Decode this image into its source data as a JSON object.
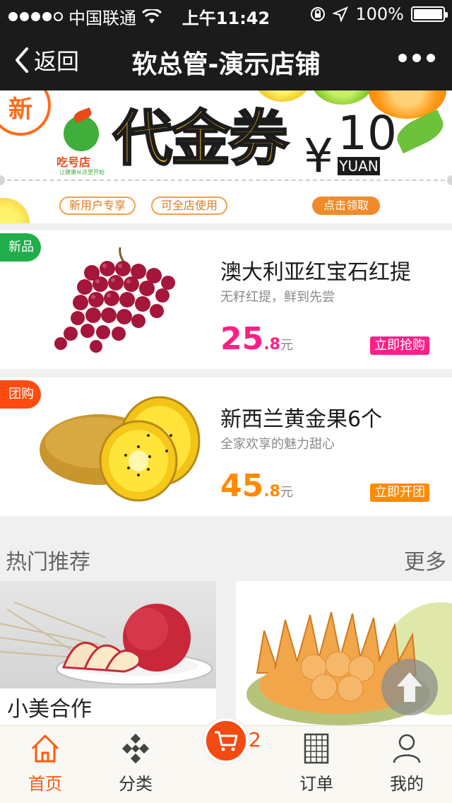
{
  "status_bar": {
    "carrier": "中国联通",
    "time": "上午11:42",
    "battery": "100%",
    "battery_level": 1.0
  },
  "nav": {
    "back_label": "返回",
    "title": "软总管-演示店铺"
  },
  "banner": {
    "new_badge": "新",
    "logo_text": "吃号店",
    "logo_sub": "让健康从这里开始",
    "title": "代金券",
    "currency": "¥",
    "amount": "10",
    "unit": "YUAN",
    "tag1": "新用户专享",
    "tag2": "可全店使用",
    "cta": "点击领取"
  },
  "products": [
    {
      "tag": "新品",
      "tag_color": "#1fae4a",
      "name": "澳大利亚红宝石红提",
      "desc": "无籽红提，鲜到先尝",
      "price_int": "25",
      "price_dec": ".8",
      "price_unit": "元",
      "price_color": "#ff1f86",
      "button": "立即抢购",
      "button_color": "#ff1f86"
    },
    {
      "tag": "团购",
      "tag_color": "#ff4a10",
      "name": "新西兰黄金果6个",
      "desc": "全家欢享的魅力甜心",
      "price_int": "45",
      "price_dec": ".8",
      "price_unit": "元",
      "price_color": "#ff8a00",
      "button": "立即开团",
      "button_color": "#ff8a00"
    }
  ],
  "recommend": {
    "title": "热门推荐",
    "more": "更多",
    "items": [
      {
        "label": "小美合作"
      }
    ]
  },
  "tabbar": {
    "tabs": [
      {
        "label": "首页",
        "icon": "home-icon",
        "active": true
      },
      {
        "label": "分类",
        "icon": "category-icon",
        "active": false
      },
      {
        "label": "订单",
        "icon": "order-icon",
        "active": false
      },
      {
        "label": "我的",
        "icon": "user-icon",
        "active": false
      }
    ],
    "cart_count": "2"
  }
}
